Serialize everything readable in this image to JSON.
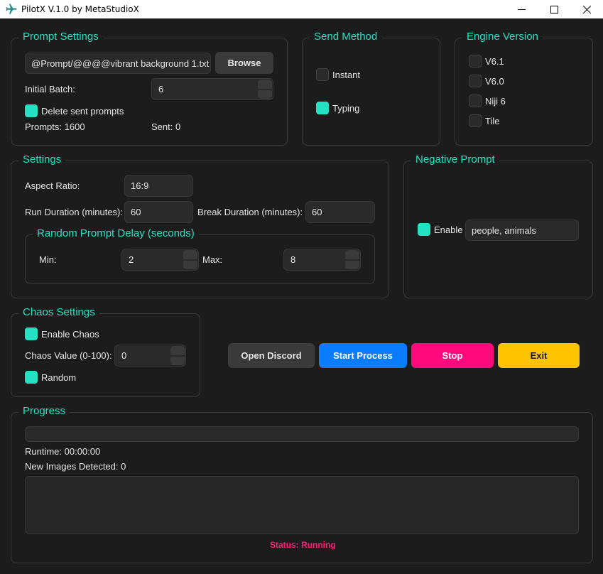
{
  "window": {
    "title": "PilotX V.1.0 by MetaStudioX"
  },
  "prompt_settings": {
    "legend": "Prompt Settings",
    "file_path": "@Prompt/@@@@vibrant background 1.txt",
    "browse_label": "Browse",
    "initial_batch_label": "Initial Batch:",
    "initial_batch_value": "6",
    "delete_sent_label": "Delete sent prompts",
    "delete_sent_checked": true,
    "prompts_count": "Prompts: 1600",
    "sent_count": "Sent: 0"
  },
  "send_method": {
    "legend": "Send Method",
    "instant_label": "Instant",
    "instant_checked": false,
    "typing_label": "Typing",
    "typing_checked": true
  },
  "engine_version": {
    "legend": "Engine Version",
    "options": [
      {
        "label": "V6.1",
        "checked": false
      },
      {
        "label": "V6.0",
        "checked": false
      },
      {
        "label": "Niji 6",
        "checked": false
      },
      {
        "label": "Tile",
        "checked": false
      }
    ]
  },
  "settings": {
    "legend": "Settings",
    "aspect_ratio_label": "Aspect Ratio:",
    "aspect_ratio_value": "16:9",
    "run_duration_label": "Run Duration (minutes):",
    "run_duration_value": "60",
    "break_duration_label": "Break Duration (minutes):",
    "break_duration_value": "60",
    "random_delay": {
      "legend": "Random Prompt Delay (seconds)",
      "min_label": "Min:",
      "min_value": "2",
      "max_label": "Max:",
      "max_value": "8"
    }
  },
  "negative_prompt": {
    "legend": "Negative Prompt",
    "enable_label": "Enable",
    "enable_checked": true,
    "value": "people, animals"
  },
  "chaos_settings": {
    "legend": "Chaos Settings",
    "enable_label": "Enable Chaos",
    "enable_checked": true,
    "value_label": "Chaos Value (0-100):",
    "value": "0",
    "random_label": "Random",
    "random_checked": true
  },
  "actions": {
    "open_discord": "Open Discord",
    "start_process": "Start Process",
    "stop": "Stop",
    "exit": "Exit"
  },
  "progress": {
    "legend": "Progress",
    "fraction": 0,
    "runtime": "Runtime: 00:00:00",
    "new_images": "New Images Detected: 0",
    "status": "Status: Running"
  },
  "colors": {
    "accent": "#24e1c4",
    "background": "#1c1c1c",
    "start_button": "#0a7cff",
    "stop_button": "#ff0a7c",
    "exit_button": "#ffc400",
    "status_text": "#ff1e7a"
  },
  "icons": {
    "app": "airplane-icon",
    "minimize": "minimize-icon",
    "maximize": "maximize-icon",
    "close": "close-icon"
  }
}
